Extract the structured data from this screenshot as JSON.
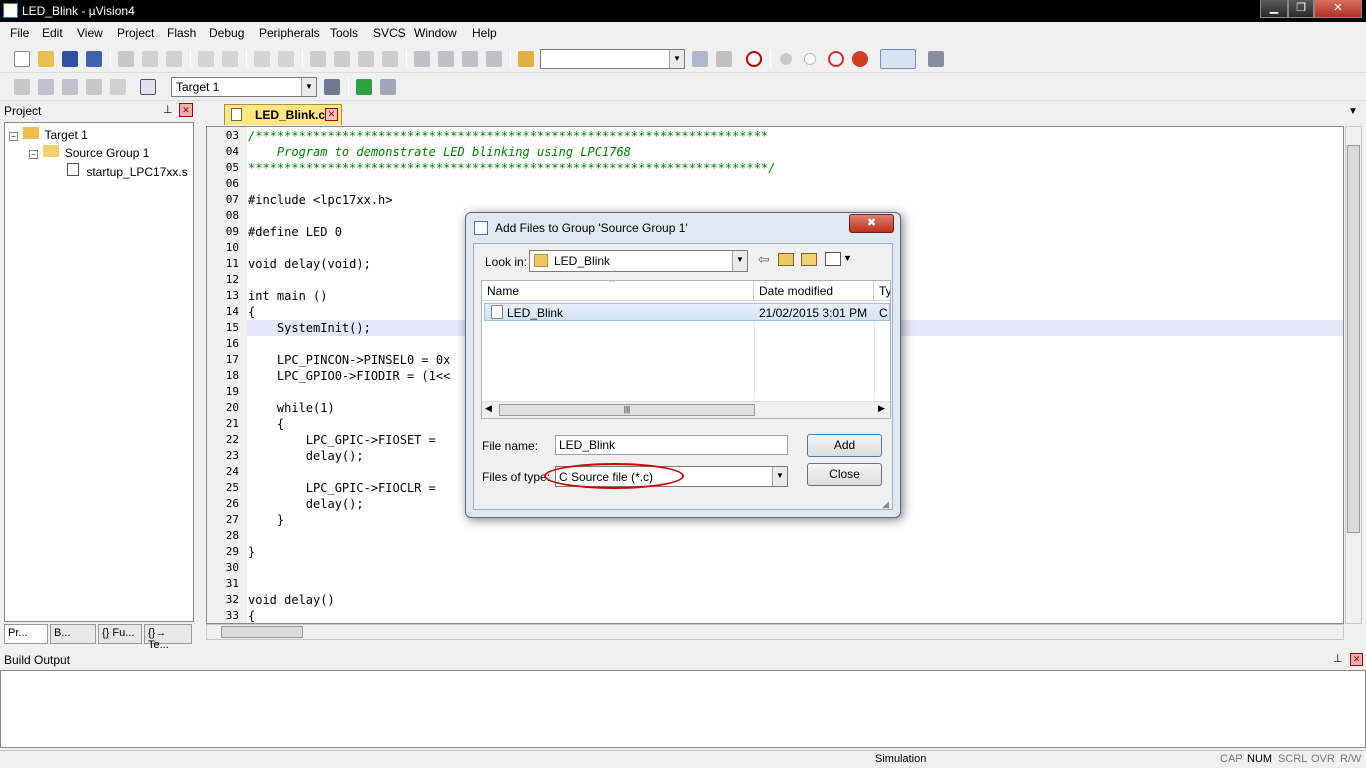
{
  "window": {
    "title": "LED_Blink  - µVision4"
  },
  "menu": [
    "File",
    "Edit",
    "View",
    "Project",
    "Flash",
    "Debug",
    "Peripherals",
    "Tools",
    "SVCS",
    "Window",
    "Help"
  ],
  "toolbar2": {
    "target": "Target 1"
  },
  "project": {
    "title": "Project",
    "tree": [
      {
        "label": "Target 1",
        "indent": 0
      },
      {
        "label": "Source Group 1",
        "indent": 1
      },
      {
        "label": "startup_LPC17xx.s",
        "indent": 2
      }
    ],
    "tabs": [
      "Pr...",
      "B...",
      "{} Fu...",
      "{}→ Te..."
    ]
  },
  "editor": {
    "tab": "LED_Blink.c",
    "lines": [
      {
        "n": "03",
        "t": "/***********************************************************************"
      },
      {
        "n": "04",
        "t": "    Program to demonstrate LED blinking using LPC1768"
      },
      {
        "n": "05",
        "t": "************************************************************************/"
      },
      {
        "n": "06",
        "t": ""
      },
      {
        "n": "07",
        "t": "#include <lpc17xx.h>"
      },
      {
        "n": "08",
        "t": ""
      },
      {
        "n": "09",
        "t": "#define LED 0"
      },
      {
        "n": "10",
        "t": ""
      },
      {
        "n": "11",
        "t": "void delay(void);"
      },
      {
        "n": "12",
        "t": ""
      },
      {
        "n": "13",
        "t": "int main ()"
      },
      {
        "n": "14",
        "t": "{"
      },
      {
        "n": "15",
        "t": "    SystemInit();"
      },
      {
        "n": "16",
        "t": ""
      },
      {
        "n": "17",
        "t": "    LPC_PINCON->PINSEL0 = 0x"
      },
      {
        "n": "18",
        "t": "    LPC_GPIO0->FIODIR = (1<<"
      },
      {
        "n": "19",
        "t": ""
      },
      {
        "n": "20",
        "t": "    while(1)"
      },
      {
        "n": "21",
        "t": "    {"
      },
      {
        "n": "22",
        "t": "        LPC_GPIC->FIOSET ="
      },
      {
        "n": "23",
        "t": "        delay();"
      },
      {
        "n": "24",
        "t": ""
      },
      {
        "n": "25",
        "t": "        LPC_GPIC->FIOCLR ="
      },
      {
        "n": "26",
        "t": "        delay();"
      },
      {
        "n": "27",
        "t": "    }"
      },
      {
        "n": "28",
        "t": ""
      },
      {
        "n": "29",
        "t": "}"
      },
      {
        "n": "30",
        "t": ""
      },
      {
        "n": "31",
        "t": ""
      },
      {
        "n": "32",
        "t": "void delay()"
      },
      {
        "n": "33",
        "t": "{"
      }
    ]
  },
  "build": {
    "title": "Build Output"
  },
  "status": {
    "mode": "Simulation",
    "indicators": [
      "CAP",
      "NUM",
      "SCRL",
      "OVR",
      "R/W"
    ]
  },
  "dialog": {
    "title": "Add Files to Group 'Source Group 1'",
    "look_in_label": "Look in:",
    "look_in_value": "LED_Blink",
    "columns": [
      "Name",
      "Date modified",
      "Ty"
    ],
    "files": [
      {
        "name": "LED_Blink",
        "date": "21/02/2015 3:01 PM",
        "type": "C"
      }
    ],
    "file_name_label": "File name:",
    "file_name_value": "LED_Blink",
    "files_of_type_label": "Files of type:",
    "files_of_type_value": "C Source file (*.c)",
    "add_button": "Add",
    "close_button": "Close",
    "close_x": "✖"
  },
  "colors": {
    "highlight_line": "#e6e6fa",
    "comment": "#008000",
    "red_circle": "#cc0000"
  }
}
